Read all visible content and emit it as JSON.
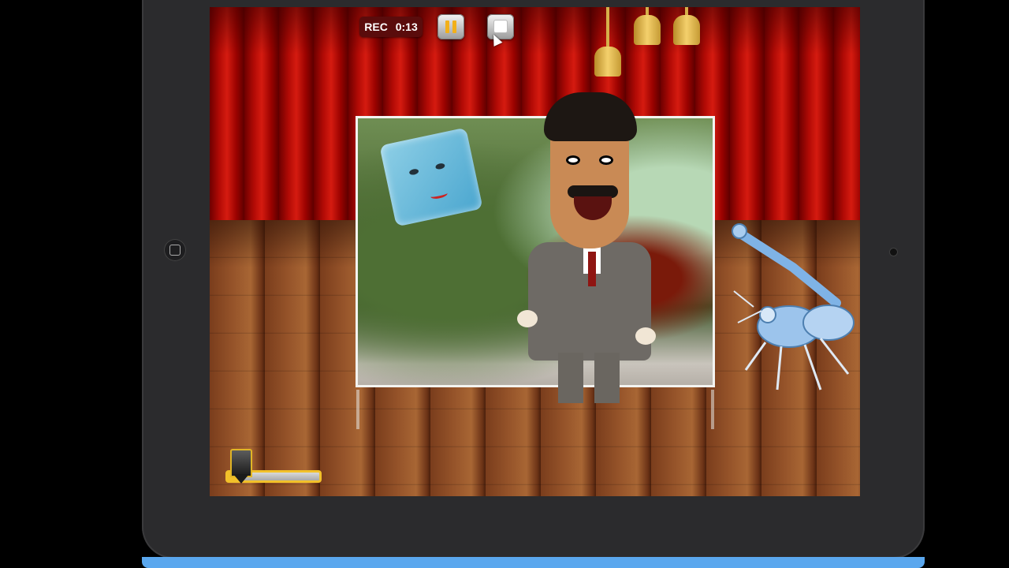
{
  "recording": {
    "label": "REC",
    "time": "0:13"
  },
  "controls": {
    "pause": "pause",
    "stop": "stop"
  },
  "icons": {
    "pause": "pause-icon",
    "stop": "stop-icon",
    "home": "home-button-icon",
    "camera": "camera-icon",
    "cursor": "mouse-pointer-icon"
  },
  "scene": {
    "backdrop": "forest-cave-backdrop",
    "actors": [
      "floating-face",
      "cartoon-man-in-suit",
      "robot-scorpion"
    ],
    "props": [
      "gold-tassel",
      "gold-tassel",
      "gold-tassel"
    ]
  },
  "volume": {
    "level": 0.15
  },
  "colors": {
    "accent": "#f2c12a",
    "rec_badge": "#5a0c0c",
    "curtain": "#c0140a",
    "device_edge": "#5aa7ee"
  }
}
